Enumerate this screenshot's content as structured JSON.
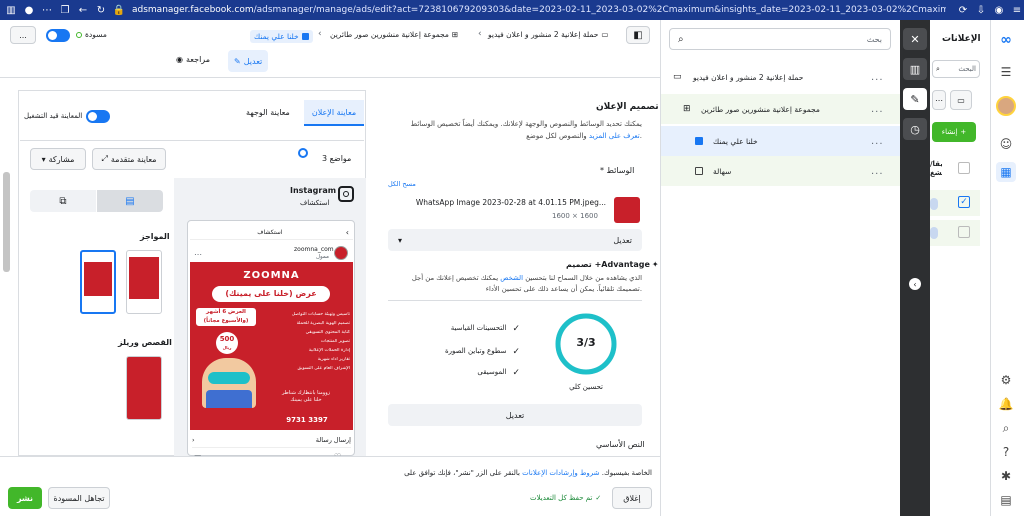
{
  "browser": {
    "url_domain": "adsmanager.facebook.com",
    "url_rest": "/adsmanager/manage/ads/edit?act=723810679209303&date=2023-02-11_2023-03-02%2Cmaximum&insights_date=2023-02-11_2023-03-02%2Cmaximum&selected_c..."
  },
  "topbar": {
    "more_label": "...",
    "draft_label": "مسودة",
    "crumb_campaign": "حملة إعلانية 2 منشور و اعلان فيديو",
    "crumb_adset": "مجموعة إعلانية منشورين صور طائرين",
    "crumb_ad": "خلنا علي يمنك",
    "tab_edit": "تعديل",
    "tab_review": "مراجعة"
  },
  "preview": {
    "tab_ad_preview": "معاينة الإعلان",
    "tab_landing": "معاينة الوجهة",
    "live_preview": "المعاينة قيد التشغيل",
    "placements": "3 مواضع",
    "advanced_preview": "معاينة متقدمة",
    "share": "مشاركة",
    "feed_label": "المواجز",
    "stories_label": "القصص وريلز",
    "instagram_label": "Instagram",
    "explore_label": "استكشاف",
    "phone_header": "استكشاف",
    "page_name": "zoomna_com",
    "sponsored": "ممول",
    "send_message": "إرسال رسالة",
    "ad_brand": "ZOOMNA",
    "ad_headline": "عرض (خلنا على يمينك)",
    "ad_offer": "العرض 6 أشهر",
    "ad_offer2": "(والأسبوع مجاناً)",
    "ad_price": "500",
    "ad_price_unit": "ريال",
    "ad_phone": "9731 3397",
    "ad_features": [
      "تأسيس وتهيئة حسابات التواصل",
      "تصميم الهوية البصرية للحملة",
      "كتابة المحتوى التسويقي",
      "تصوير المنتجات",
      "إدارة الحملات الإعلانية",
      "تقارير أداء شهرية",
      "الإشراف العام على التسويق"
    ],
    "ad_tagline": "زوومنا بانتظارك شناطر",
    "ad_tagline2": "خلنا على يمينك"
  },
  "design": {
    "title": "تصميم الإعلان",
    "desc1": "يمكنك تحديد الوسائط والنصوص والوجهة لإعلانك. ويمكنك أيضاً تخصيص الوسائط",
    "desc2": "والنصوص لكل موضع.",
    "learn_more": "تعرف على المزيد",
    "media_label": "* الوسائط",
    "clear_all": "مسح الكل",
    "file_name": "WhatsApp Image 2023-02-28 at 4.01.15 PM.jpeg...",
    "file_dims": "1600 × 1600",
    "edit_dropdown": "تعديل",
    "advantage_title": "تصميم +Advantage",
    "adv_desc1": "يمكنك تخصيص إعلانك من أجل",
    "adv_desc_link": "الشخص",
    "adv_desc2": "الذي يشاهده من خلال السماح لنا بتحسين",
    "adv_desc3": "تصميمك تلقائياً. يمكن أن يساعد ذلك على تحسين الأداء.",
    "opt1": "التحسينات القياسية",
    "opt2": "سطوع وتباين الصورة",
    "opt3": "الموسيقى",
    "score": "3/3",
    "score_label": "تحسين كلي",
    "score_fraction": 1.0,
    "edit_button": "تعديل",
    "primary_text": "النص الأساسي"
  },
  "footer": {
    "terms_pre": "بالنقر على الزر \"نشر\"، فإنك توافق على",
    "terms_link": "شروط وإرشادات الإعلانات",
    "terms_post": "الخاصة بفيسبوك.",
    "close": "إغلاق",
    "saved": "تم حفظ كل التعديلات",
    "discard": "تجاهل المسودة",
    "publish": "نشر"
  },
  "tree": {
    "search_placeholder": "بحث",
    "rows": [
      {
        "label": "حملة إعلانية 2 منشور و اعلان فيديو",
        "more": "..."
      },
      {
        "label": "مجموعة إعلانية منشورين صور طائرين",
        "more": "..."
      },
      {
        "label": "خلنا علي يمنك",
        "more": "..."
      },
      {
        "label": "سهالة",
        "more": "..."
      }
    ]
  },
  "rightnav": {
    "ads_title": "الإعلانات",
    "search_label": "البحث",
    "create_label": "إنشاء",
    "col_label": "إيقا/تشغ"
  },
  "colors": {
    "accent": "#1877f2",
    "publish": "#42b72a",
    "teal": "#1ec0c9",
    "ad_red": "#c8202a"
  }
}
